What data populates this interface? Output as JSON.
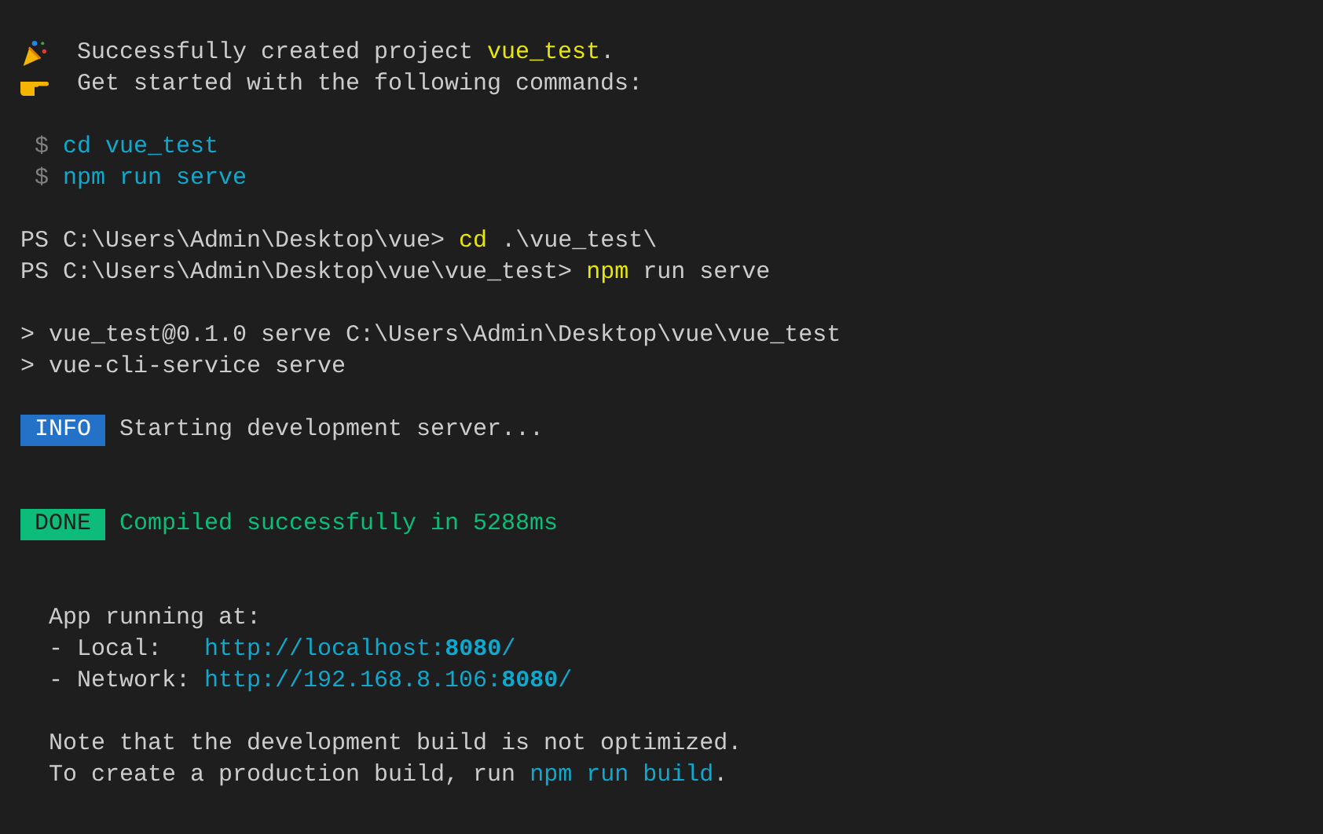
{
  "terminal": {
    "lines": [
      {
        "kind": "blank"
      },
      {
        "kind": "success",
        "segments": [
          {
            "color": "#cccccc",
            "text": "Successfully created project "
          },
          {
            "color": "#e5e510",
            "text": "vue_test"
          },
          {
            "color": "#cccccc",
            "text": "."
          }
        ]
      },
      {
        "kind": "hint",
        "segments": [
          {
            "color": "#cccccc",
            "text": "Get started with the following commands:"
          }
        ]
      },
      {
        "kind": "blank"
      },
      {
        "kind": "text",
        "segments": [
          {
            "color": "#808080",
            "text": " $ "
          },
          {
            "color": "#11a8cd",
            "text": "cd vue_test"
          }
        ]
      },
      {
        "kind": "text",
        "segments": [
          {
            "color": "#808080",
            "text": " $ "
          },
          {
            "color": "#11a8cd",
            "text": "npm run serve"
          }
        ]
      },
      {
        "kind": "blank"
      },
      {
        "kind": "text",
        "segments": [
          {
            "color": "#cccccc",
            "text": "PS C:\\Users\\Admin\\Desktop\\vue> "
          },
          {
            "color": "#e5e510",
            "text": "cd"
          },
          {
            "color": "#cccccc",
            "text": " .\\vue_test\\"
          }
        ]
      },
      {
        "kind": "text",
        "segments": [
          {
            "color": "#cccccc",
            "text": "PS C:\\Users\\Admin\\Desktop\\vue\\vue_test> "
          },
          {
            "color": "#e5e510",
            "text": "npm"
          },
          {
            "color": "#cccccc",
            "text": " run serve"
          }
        ]
      },
      {
        "kind": "blank"
      },
      {
        "kind": "text",
        "segments": [
          {
            "color": "#cccccc",
            "text": "> vue_test@0.1.0 serve C:\\Users\\Admin\\Desktop\\vue\\vue_test"
          }
        ]
      },
      {
        "kind": "text",
        "segments": [
          {
            "color": "#cccccc",
            "text": "> vue-cli-service serve"
          }
        ]
      },
      {
        "kind": "blank"
      },
      {
        "kind": "text",
        "badge": {
          "kind": "info",
          "text": "INFO"
        },
        "segments": [
          {
            "color": "#cccccc",
            "text": "Starting development server..."
          }
        ]
      },
      {
        "kind": "blank"
      },
      {
        "kind": "blank"
      },
      {
        "kind": "text",
        "badge": {
          "kind": "done",
          "text": "DONE"
        },
        "segments": [
          {
            "color": "#0dbc79",
            "text": "Compiled successfully in 5288ms"
          }
        ]
      },
      {
        "kind": "blank"
      },
      {
        "kind": "blank"
      },
      {
        "kind": "text",
        "segments": [
          {
            "color": "#cccccc",
            "text": "  App running at:"
          }
        ]
      },
      {
        "kind": "text",
        "segments": [
          {
            "color": "#cccccc",
            "text": "  - Local:   "
          },
          {
            "color": "#11a8cd",
            "text": "http://localhost:**8080**/"
          }
        ]
      },
      {
        "kind": "text",
        "segments": [
          {
            "color": "#cccccc",
            "text": "  - Network: "
          },
          {
            "color": "#11a8cd",
            "text": "http://192.168.8.106:**8080**/"
          }
        ]
      },
      {
        "kind": "blank"
      },
      {
        "kind": "text",
        "segments": [
          {
            "color": "#cccccc",
            "text": "  Note that the development build is not optimized."
          }
        ]
      },
      {
        "kind": "text",
        "segments": [
          {
            "color": "#cccccc",
            "text": "  To create a production build, run "
          },
          {
            "color": "#11a8cd",
            "text": "npm run build"
          },
          {
            "color": "#cccccc",
            "text": "."
          }
        ]
      }
    ]
  }
}
